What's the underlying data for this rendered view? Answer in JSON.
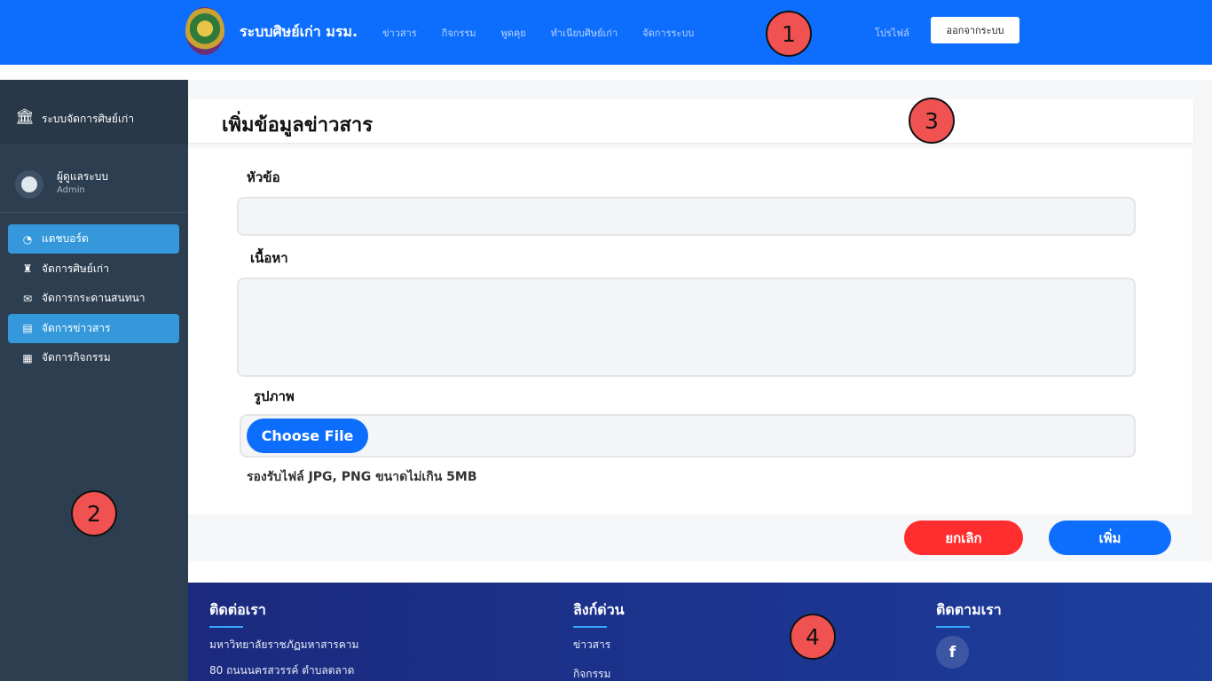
{
  "navbar": {
    "brand": "ระบบศิษย์เก่า มรม.",
    "links": [
      "ข่าวสาร",
      "กิจกรรม",
      "พูดคุย",
      "ทำเนียบศิษย์เก่า",
      "จัดการระบบ"
    ],
    "profile": "โปรไฟล์",
    "logout": "ออกจากระบบ",
    "bg_color": "#0d6efd"
  },
  "markers": [
    "1",
    "2",
    "3",
    "4"
  ],
  "sidebar": {
    "title": "ระบบจัดการศิษย์เก่า",
    "user_name": "ผู้ดูแลระบบ",
    "user_role": "Admin",
    "items": [
      {
        "label": "แดชบอร์ด",
        "icon": "dashboard-icon",
        "active": true
      },
      {
        "label": "จัดการศิษย์เก่า",
        "icon": "graduate-icon",
        "active": false
      },
      {
        "label": "จัดการกระดานสนทนา",
        "icon": "comments-icon",
        "active": false
      },
      {
        "label": "จัดการข่าวสาร",
        "icon": "newspaper-icon",
        "active": true
      },
      {
        "label": "จัดการกิจกรรม",
        "icon": "calendar-icon",
        "active": false
      }
    ],
    "bg_color": "#2c3e50",
    "active_color": "#3498db"
  },
  "main": {
    "page_title": "เพิ่มข้อมูลข่าวสาร",
    "fields": {
      "title_label": "หัวข้อ",
      "title_value": "",
      "content_label": "เนื้อหา",
      "content_value": "",
      "image_label": "รูปภาพ",
      "file_button": "Choose File",
      "file_hint": "รองรับไฟล์ JPG, PNG ขนาดไม่เกิน 5MB"
    },
    "buttons": {
      "cancel": "ยกเลิก",
      "add": "เพิ่ม"
    }
  },
  "footer": {
    "contact_heading": "ติดต่อเรา",
    "contact_lines": [
      "มหาวิทยาลัยราชภัฏมหาสารคาม",
      "80 ถนนนครสวรรค์ ตำบลตลาด"
    ],
    "quick_heading": "ลิงก์ด่วน",
    "quick_links": [
      "ข่าวสาร",
      "กิจกรรม"
    ],
    "follow_heading": "ติดตามเรา",
    "social": "f"
  }
}
